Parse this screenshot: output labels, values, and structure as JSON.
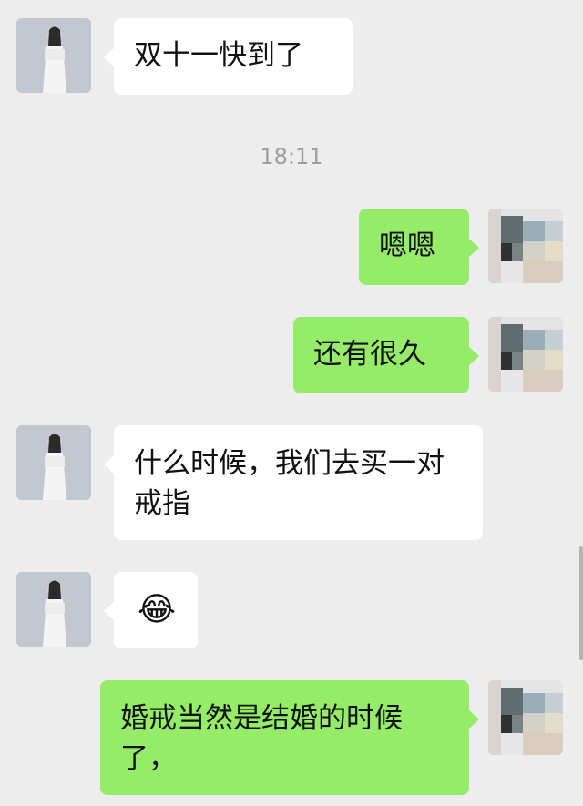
{
  "conversation": {
    "timestamp": "18:11",
    "messages": [
      {
        "direction": "incoming",
        "text": "双十一快到了"
      },
      {
        "direction": "outgoing",
        "text": "嗯嗯"
      },
      {
        "direction": "outgoing",
        "text": "还有很久"
      },
      {
        "direction": "incoming",
        "text": "什么时候，我们去买一对戒指"
      },
      {
        "direction": "incoming",
        "emoji": "😂"
      },
      {
        "direction": "outgoing",
        "text": "婚戒当然是结婚的时候了，"
      }
    ]
  },
  "colors": {
    "background": "#ededed",
    "incoming_bubble": "#ffffff",
    "outgoing_bubble": "#95ec69",
    "timestamp": "#9e9e9e"
  },
  "icons": {
    "incoming_avatar": "woman-in-white-dress-photo-blurred",
    "outgoing_avatar": "pixelated-photo",
    "emoji": "face-with-tears-of-joy"
  }
}
